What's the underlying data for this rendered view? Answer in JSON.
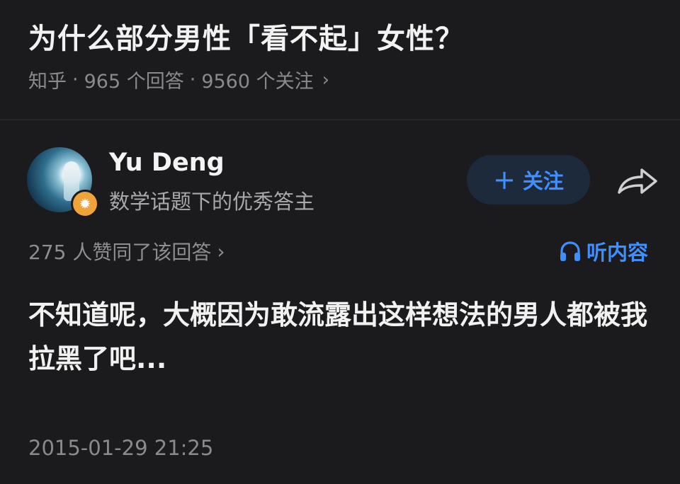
{
  "question": {
    "title": "为什么部分男性「看不起」女性？",
    "source": "知乎",
    "answers_count": "965 个回答",
    "followers_count": "9560 个关注",
    "separator": "·"
  },
  "author": {
    "name": "Yu Deng",
    "bio": "数学话题下的优秀答主",
    "badge_icon": "flame-icon",
    "follow_label": "关注",
    "share_icon": "share-arrow-icon"
  },
  "answer": {
    "upvote_text": "275 人赞同了该回答",
    "listen_label": "听内容",
    "content": "不知道呢，大概因为敢流露出这样想法的男人都被我拉黑了吧...",
    "timestamp": "2015-01-29 21:25"
  },
  "colors": {
    "background": "#1b1b1d",
    "accent": "#3f8fff",
    "muted": "#8a8a8e",
    "badge": "#f0a33b"
  }
}
